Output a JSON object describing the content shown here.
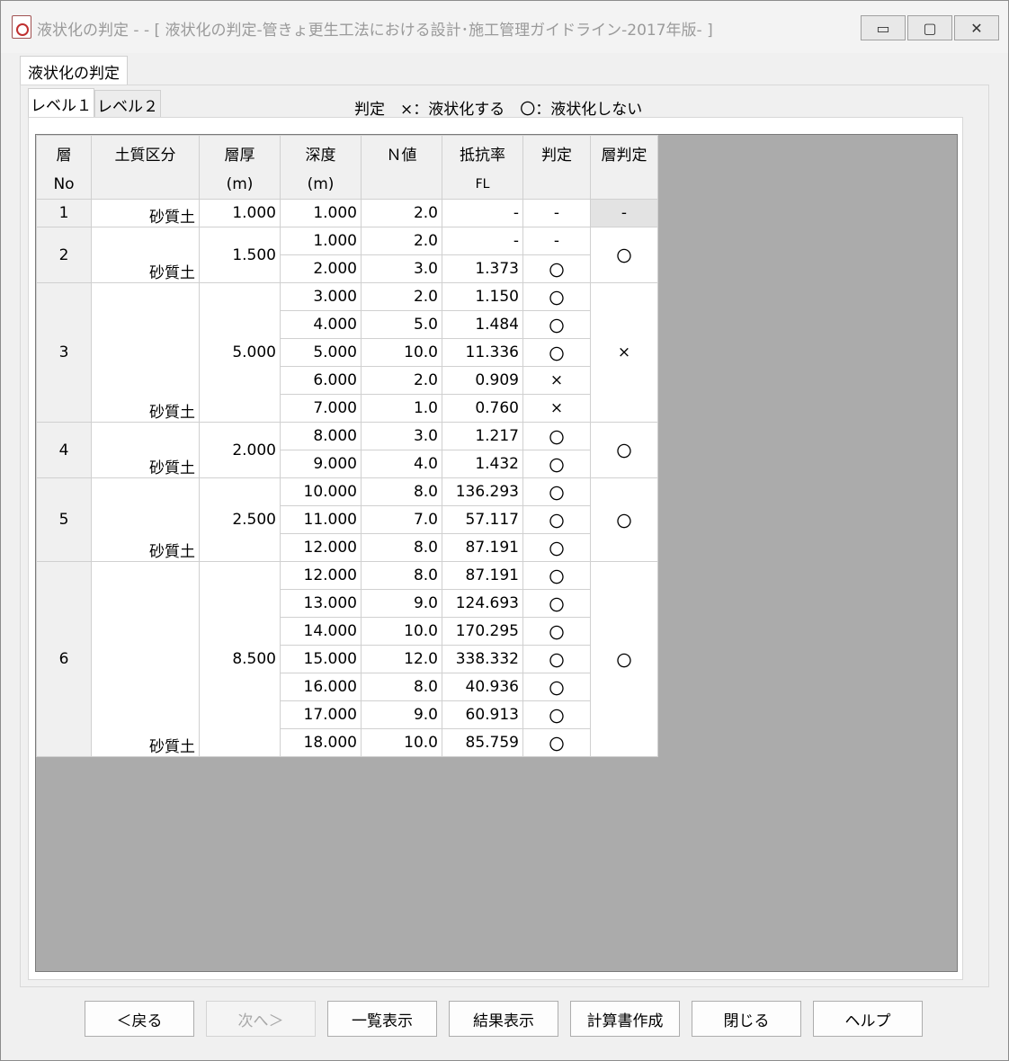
{
  "window": {
    "title": "液状化の判定 -  - [ 液状化の判定-管きょ更生工法における設計･施工管理ガイドライン-2017年版- ]",
    "controls": {
      "minimize": "▭",
      "maximize": "▢",
      "close": "✕"
    }
  },
  "outer_tab": {
    "label": "液状化の判定"
  },
  "inner_tabs": [
    {
      "label": "レベル１"
    },
    {
      "label": "レベル２"
    }
  ],
  "legend": "判定　×：液状化する　〇：液状化しない",
  "table": {
    "headers": {
      "no": [
        "層",
        "No"
      ],
      "soil": [
        "土質区分",
        ""
      ],
      "thick": [
        "層厚",
        "(m)"
      ],
      "depth": [
        "深度",
        "(m)"
      ],
      "nval": [
        "Ｎ値",
        ""
      ],
      "fl": [
        "抵抗率",
        "FL"
      ],
      "judge": [
        "判定",
        ""
      ],
      "ljudge": [
        "層判定",
        ""
      ]
    },
    "layers": [
      {
        "no": "1",
        "soil": "砂質土",
        "thickness": "1.000",
        "layer_judge": "-",
        "rows": [
          {
            "depth": "1.000",
            "n": "2.0",
            "fl": "-",
            "judge": "-"
          }
        ]
      },
      {
        "no": "2",
        "soil": "砂質土",
        "thickness": "1.500",
        "layer_judge": "〇",
        "rows": [
          {
            "depth": "1.000",
            "n": "2.0",
            "fl": "-",
            "judge": "-"
          },
          {
            "depth": "2.000",
            "n": "3.0",
            "fl": "1.373",
            "judge": "〇"
          }
        ]
      },
      {
        "no": "3",
        "soil": "砂質土",
        "thickness": "5.000",
        "layer_judge": "×",
        "rows": [
          {
            "depth": "3.000",
            "n": "2.0",
            "fl": "1.150",
            "judge": "〇"
          },
          {
            "depth": "4.000",
            "n": "5.0",
            "fl": "1.484",
            "judge": "〇"
          },
          {
            "depth": "5.000",
            "n": "10.0",
            "fl": "11.336",
            "judge": "〇"
          },
          {
            "depth": "6.000",
            "n": "2.0",
            "fl": "0.909",
            "judge": "×"
          },
          {
            "depth": "7.000",
            "n": "1.0",
            "fl": "0.760",
            "judge": "×"
          }
        ]
      },
      {
        "no": "4",
        "soil": "砂質土",
        "thickness": "2.000",
        "layer_judge": "〇",
        "rows": [
          {
            "depth": "8.000",
            "n": "3.0",
            "fl": "1.217",
            "judge": "〇"
          },
          {
            "depth": "9.000",
            "n": "4.0",
            "fl": "1.432",
            "judge": "〇"
          }
        ]
      },
      {
        "no": "5",
        "soil": "砂質土",
        "thickness": "2.500",
        "layer_judge": "〇",
        "rows": [
          {
            "depth": "10.000",
            "n": "8.0",
            "fl": "136.293",
            "judge": "〇"
          },
          {
            "depth": "11.000",
            "n": "7.0",
            "fl": "57.117",
            "judge": "〇"
          },
          {
            "depth": "12.000",
            "n": "8.0",
            "fl": "87.191",
            "judge": "〇"
          }
        ]
      },
      {
        "no": "6",
        "soil": "砂質土",
        "thickness": "8.500",
        "layer_judge": "〇",
        "rows": [
          {
            "depth": "12.000",
            "n": "8.0",
            "fl": "87.191",
            "judge": "〇"
          },
          {
            "depth": "13.000",
            "n": "9.0",
            "fl": "124.693",
            "judge": "〇"
          },
          {
            "depth": "14.000",
            "n": "10.0",
            "fl": "170.295",
            "judge": "〇"
          },
          {
            "depth": "15.000",
            "n": "12.0",
            "fl": "338.332",
            "judge": "〇"
          },
          {
            "depth": "16.000",
            "n": "8.0",
            "fl": "40.936",
            "judge": "〇"
          },
          {
            "depth": "17.000",
            "n": "9.0",
            "fl": "60.913",
            "judge": "〇"
          },
          {
            "depth": "18.000",
            "n": "10.0",
            "fl": "85.759",
            "judge": "〇"
          }
        ]
      }
    ]
  },
  "buttons": [
    {
      "label": "＜戻る",
      "name": "back-button",
      "disabled": false
    },
    {
      "label": "次へ＞",
      "name": "next-button",
      "disabled": true
    },
    {
      "label": "一覧表示",
      "name": "list-view-button",
      "disabled": false
    },
    {
      "label": "結果表示",
      "name": "result-view-button",
      "disabled": false
    },
    {
      "label": "計算書作成",
      "name": "create-report-button",
      "disabled": false
    },
    {
      "label": "閉じる",
      "name": "close-button",
      "disabled": false
    },
    {
      "label": "ヘルプ",
      "name": "help-button",
      "disabled": false
    }
  ]
}
